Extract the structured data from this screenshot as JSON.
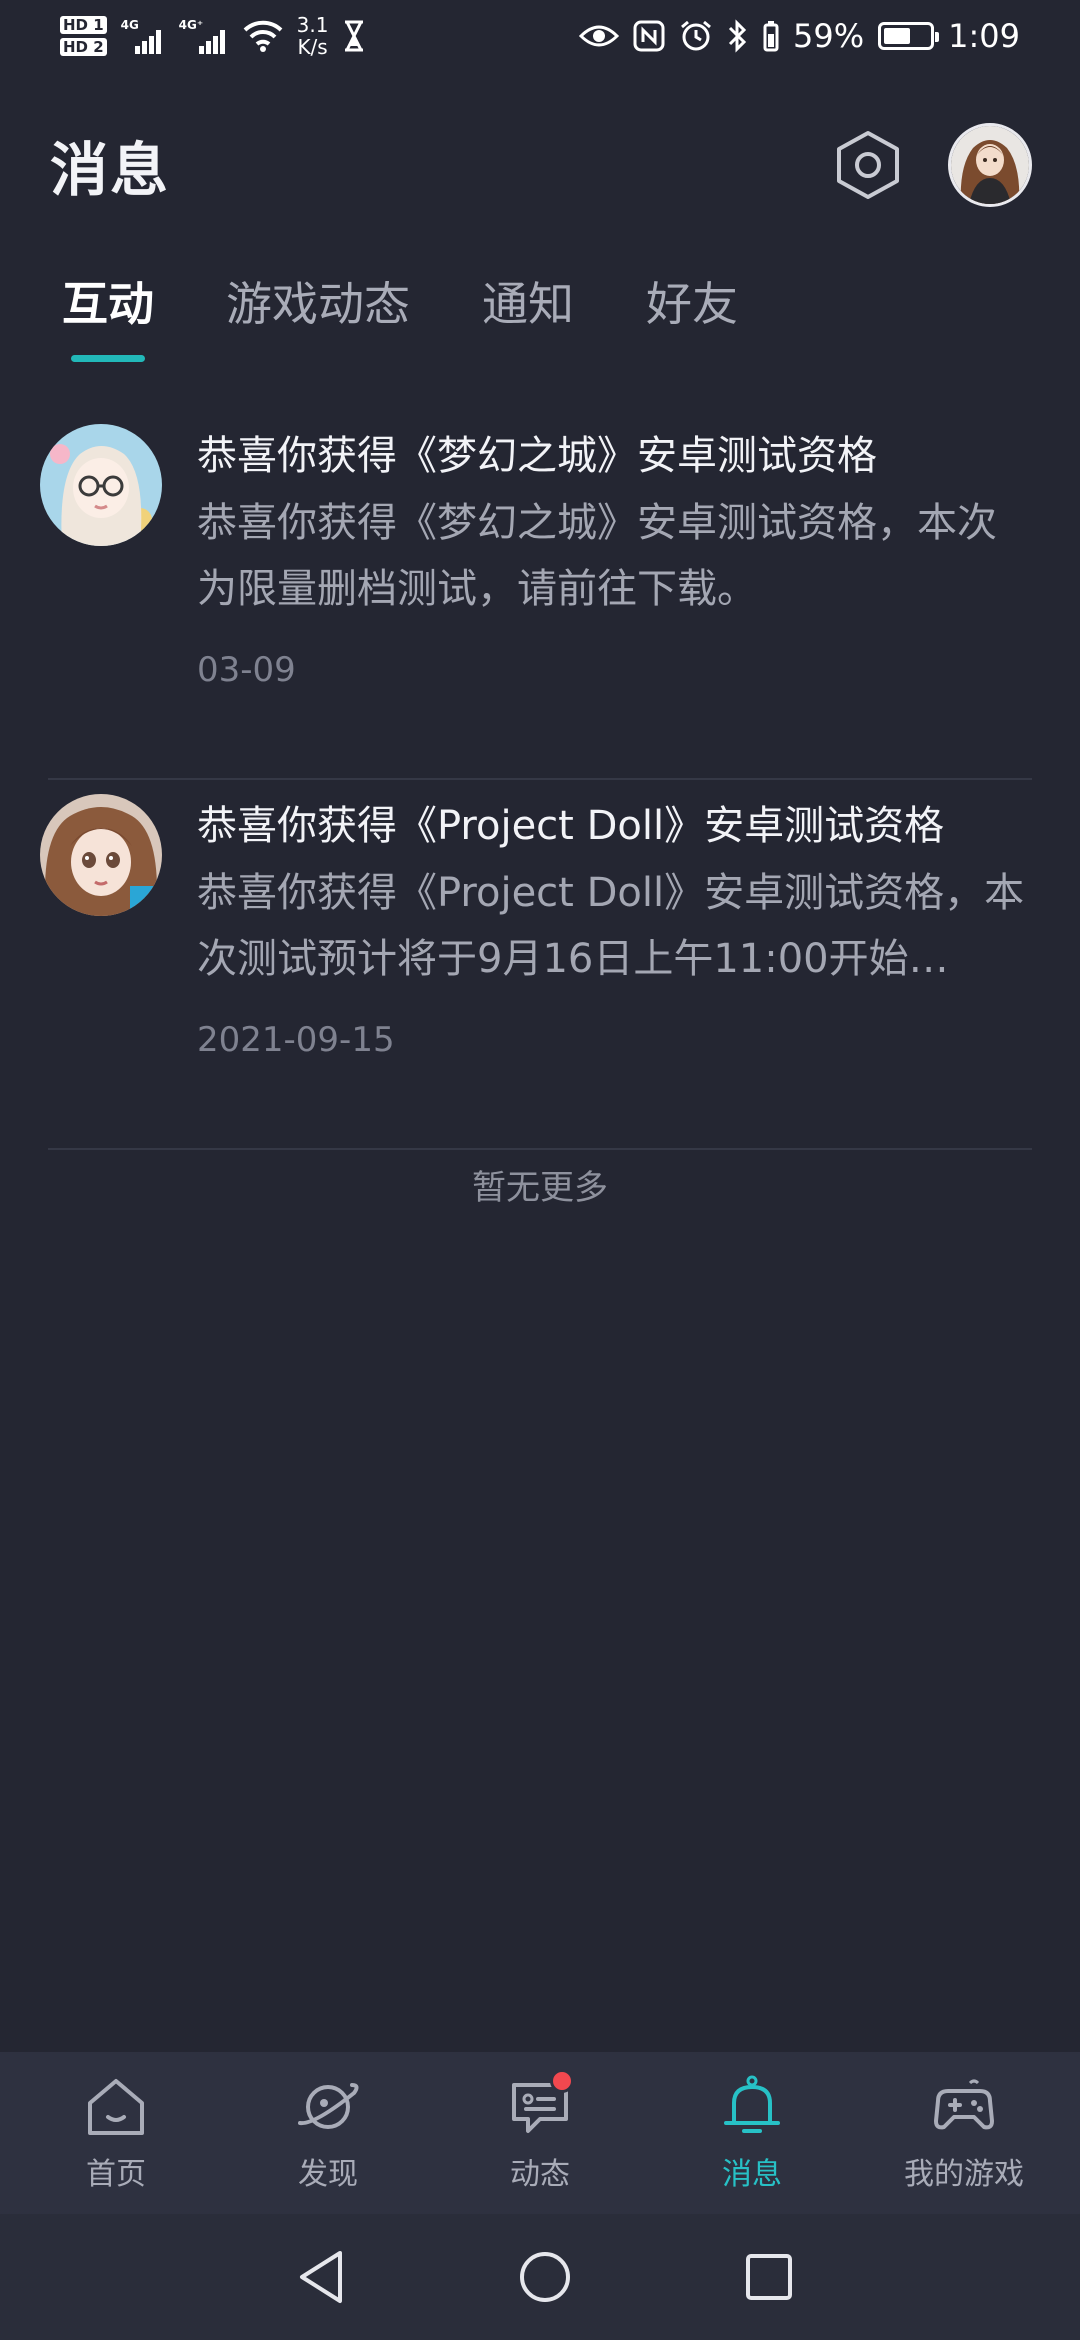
{
  "status_bar": {
    "sim1": "HD 1",
    "sim2": "HD 2",
    "net1": "4G",
    "net2": "4G⁺",
    "speed_value": "3.1",
    "speed_unit": "K/s",
    "battery": "59%",
    "time": "1:09",
    "icons": [
      "hourglass-icon",
      "eye-icon",
      "nfc-icon",
      "alarm-icon",
      "bluetooth-icon",
      "battery-icon"
    ]
  },
  "header": {
    "title": "消息",
    "settings_icon": "hexagon-gear-icon"
  },
  "tabs": [
    {
      "label": "互动",
      "active": true
    },
    {
      "label": "游戏动态",
      "active": false
    },
    {
      "label": "通知",
      "active": false
    },
    {
      "label": "好友",
      "active": false
    }
  ],
  "messages": [
    {
      "title": "恭喜你获得《梦幻之城》安卓测试资格",
      "text": "恭喜你获得《梦幻之城》安卓测试资格，本次为限量删档测试，请前往下载。",
      "date": "03-09"
    },
    {
      "title": "恭喜你获得《Project Doll》安卓测试资格",
      "text": "恭喜你获得《Project Doll》安卓测试资格，本次测试预计将于9月16日上午11:00开始…",
      "date": "2021-09-15"
    }
  ],
  "list_footer": "暂无更多",
  "bottom_nav": [
    {
      "label": "首页",
      "icon": "home-icon",
      "active": false
    },
    {
      "label": "发现",
      "icon": "planet-icon",
      "active": false
    },
    {
      "label": "动态",
      "icon": "chat-bubble-icon",
      "active": false,
      "badge": true
    },
    {
      "label": "消息",
      "icon": "bell-icon",
      "active": true
    },
    {
      "label": "我的游戏",
      "icon": "gamepad-icon",
      "active": false
    }
  ],
  "colors": {
    "background": "#242632",
    "accent": "#22b8b9",
    "badge": "#f2484f",
    "nav_background": "#2e3140"
  }
}
